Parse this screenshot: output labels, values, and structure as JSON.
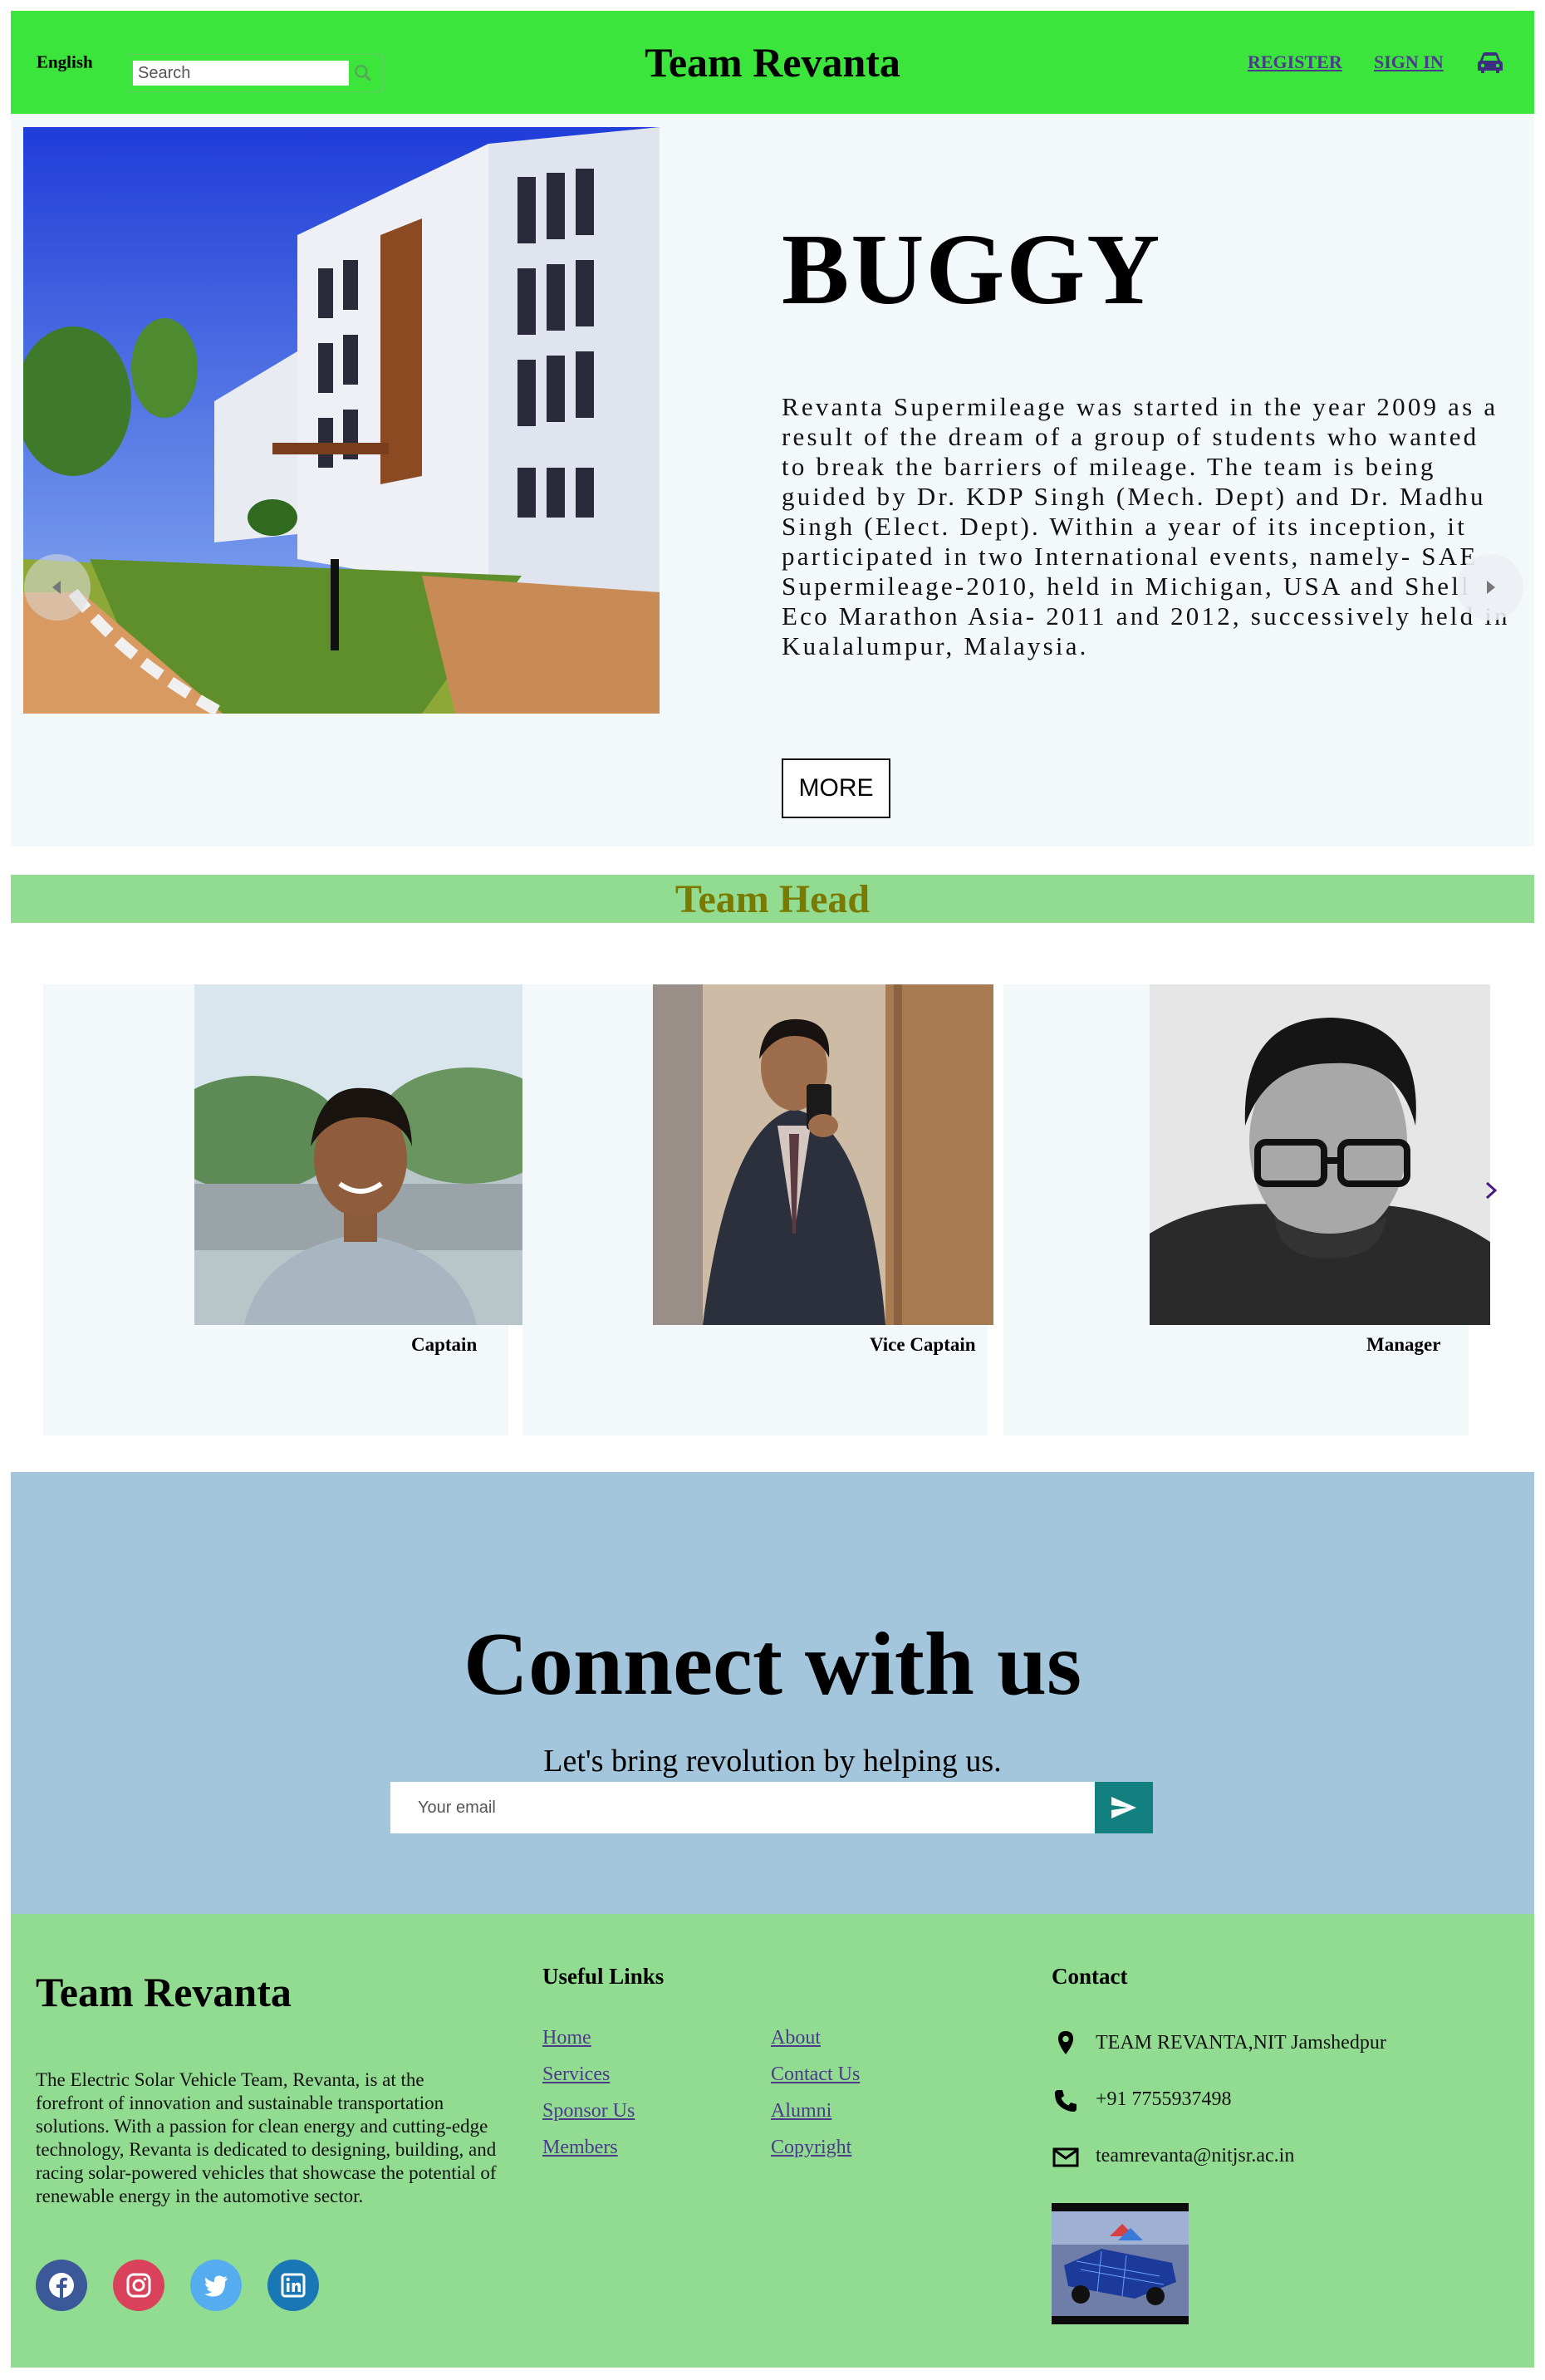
{
  "header": {
    "language": "English",
    "search_placeholder": "Search",
    "brand": "Team Revanta",
    "register": "REGISTER",
    "signin": "SIGN IN",
    "icons": [
      "search-icon",
      "car-icon"
    ],
    "bg_color": "#3be53b"
  },
  "hero": {
    "title": "BUGGY",
    "text": "Revanta Supermileage was started in the year 2009 as a result of the dream of a group of students who wanted to break the barriers of mileage. The team is being guided by Dr. KDP Singh (Mech. Dept) and Dr. Madhu Singh (Elect. Dept). Within a year of its inception, it participated in two International events, namely- SAE Supermileage-2010, held in Michigan, USA and Shell Eco Marathon Asia- 2011 and 2012, successively held in Kualalumpur, Malaysia.",
    "more_label": "MORE"
  },
  "team": {
    "heading": "Team Head",
    "members": [
      {
        "role": "Captain"
      },
      {
        "role": "Vice Captain"
      },
      {
        "role": "Manager"
      }
    ]
  },
  "connect": {
    "title": "Connect with us",
    "subtitle": "Let's bring revolution by helping us.",
    "email_placeholder": "Your email",
    "bg_color": "#a4c6dc",
    "button_color": "#138080"
  },
  "footer": {
    "brand": "Team Revanta",
    "description": "The Electric Solar Vehicle Team, Revanta, is at the forefront of innovation and sustainable transportation solutions. With a passion for clean energy and cutting-edge technology, Revanta is dedicated to designing, building, and racing solar-powered vehicles that showcase the potential of renewable energy in the automotive sector.",
    "social": [
      "facebook-icon",
      "instagram-icon",
      "twitter-icon",
      "linkedin-icon"
    ],
    "useful_links_heading": "Useful Links",
    "links_col1": [
      "Home",
      "Services",
      "Sponsor Us",
      "Members"
    ],
    "links_col2": [
      "About",
      "Contact Us",
      "Alumni",
      "Copyright"
    ],
    "contact_heading": "Contact",
    "address": "TEAM REVANTA,NIT Jamshedpur",
    "phone": "+91 7755937498",
    "email": "teamrevanta@nitjsr.ac.in",
    "bg_color": "#92dc92"
  }
}
